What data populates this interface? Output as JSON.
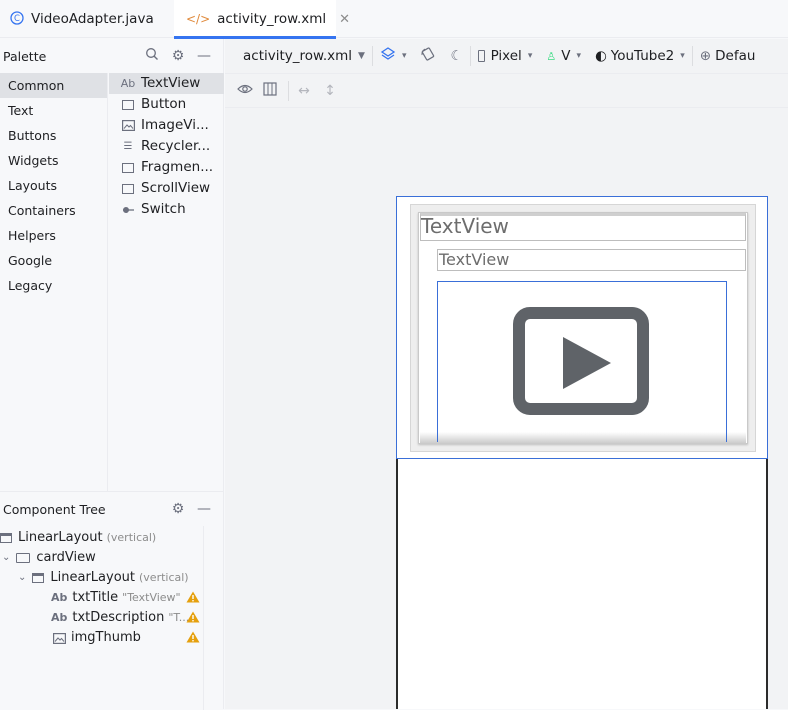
{
  "tabs": [
    {
      "label": "VideoAdapter.java",
      "icon": "java-class-icon"
    },
    {
      "label": "activity_row.xml",
      "icon": "xml-icon"
    }
  ],
  "palette": {
    "title": "Palette",
    "categories": [
      "Common",
      "Text",
      "Buttons",
      "Widgets",
      "Layouts",
      "Containers",
      "Helpers",
      "Google",
      "Legacy"
    ],
    "selected_category": "Common",
    "widgets": [
      {
        "label": "TextView",
        "icon": "Ab"
      },
      {
        "label": "Button",
        "icon": "box"
      },
      {
        "label": "ImageVi...",
        "icon": "image"
      },
      {
        "label": "Recycler...",
        "icon": "list"
      },
      {
        "label": "Fragmen...",
        "icon": "box"
      },
      {
        "label": "ScrollView",
        "icon": "scroll"
      },
      {
        "label": "Switch",
        "icon": "switch"
      }
    ]
  },
  "component_tree": {
    "title": "Component Tree",
    "nodes": [
      {
        "label": "LinearLayout",
        "hint": "(vertical)"
      },
      {
        "label": "cardView",
        "hint": ""
      },
      {
        "label": "LinearLayout",
        "hint": "(vertical)"
      },
      {
        "label": "txtTitle",
        "hint": "\"TextView\""
      },
      {
        "label": "txtDescription",
        "hint": "\"T..."
      },
      {
        "label": "imgThumb",
        "hint": ""
      }
    ]
  },
  "toolbar": {
    "file": "activity_row.xml",
    "device": "Pixel",
    "api": "V",
    "theme": "YouTube2",
    "locale": "Defau"
  },
  "preview": {
    "title_text": "TextView",
    "description_text": "TextView"
  },
  "colors": {
    "accent": "#3574f0",
    "selection": "#3a6fd8",
    "warning": "#e5a00d"
  }
}
